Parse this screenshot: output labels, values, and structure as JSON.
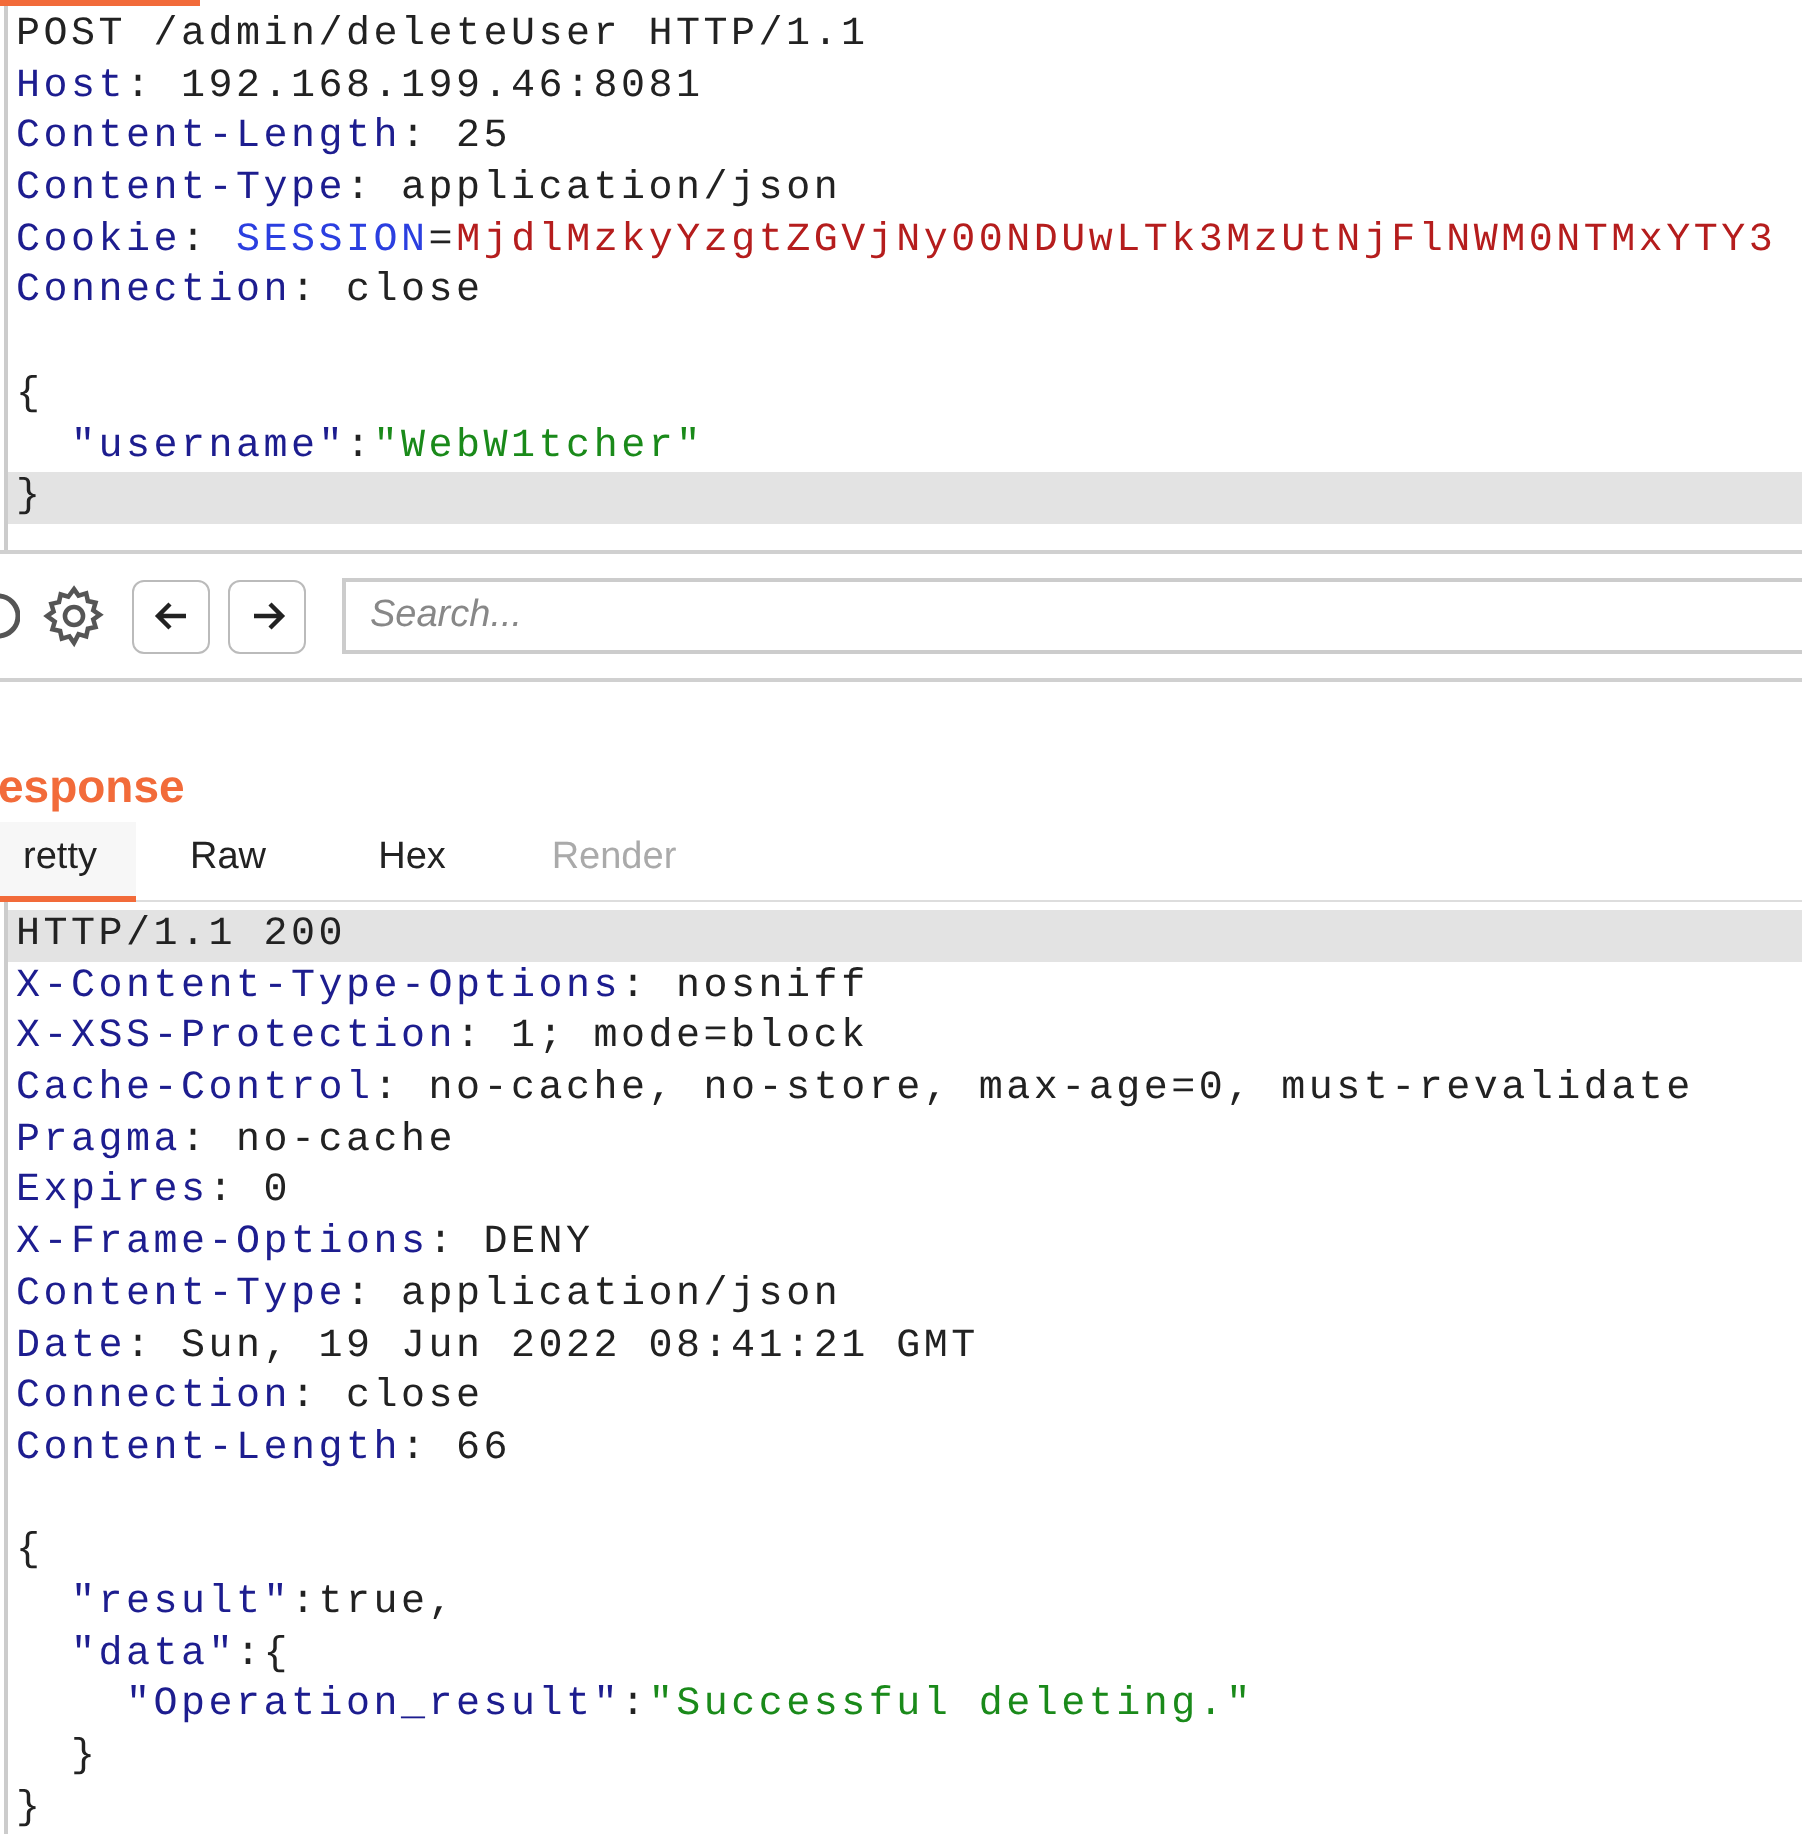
{
  "request": {
    "lines": [
      {
        "current": false,
        "tokens": [
          {
            "kind": "plain",
            "text": "POST /admin/deleteUser HTTP/1.1"
          }
        ]
      },
      {
        "current": false,
        "tokens": [
          {
            "kind": "header",
            "text": "Host"
          },
          {
            "kind": "plain",
            "text": ": 192.168.199.46:8081"
          }
        ]
      },
      {
        "current": false,
        "tokens": [
          {
            "kind": "header",
            "text": "Content-Length"
          },
          {
            "kind": "plain",
            "text": ": 25"
          }
        ]
      },
      {
        "current": false,
        "tokens": [
          {
            "kind": "header",
            "text": "Content-Type"
          },
          {
            "kind": "plain",
            "text": ": application/json"
          }
        ]
      },
      {
        "current": false,
        "tokens": [
          {
            "kind": "header",
            "text": "Cookie"
          },
          {
            "kind": "plain",
            "text": ": "
          },
          {
            "kind": "cookie_name",
            "text": "SESSION"
          },
          {
            "kind": "plain",
            "text": "="
          },
          {
            "kind": "cookie_value",
            "text": "MjdlMzkyYzgtZGVjNy00NDUwLTk3MzUtNjFlNWM0NTMxYTY3"
          }
        ]
      },
      {
        "current": false,
        "tokens": [
          {
            "kind": "header",
            "text": "Connection"
          },
          {
            "kind": "plain",
            "text": ": close"
          }
        ]
      },
      {
        "current": false
      },
      {
        "current": false,
        "tokens": [
          {
            "kind": "plain",
            "text": "{"
          }
        ]
      },
      {
        "current": false,
        "tokens": [
          {
            "kind": "json_key",
            "text": "  \"username\""
          },
          {
            "kind": "plain",
            "text": ":"
          },
          {
            "kind": "json_string",
            "text": "\"WebW1tcher\""
          }
        ]
      },
      {
        "current": true,
        "tokens": [
          {
            "kind": "plain",
            "text": "}"
          }
        ]
      }
    ]
  },
  "toolbar": {
    "search": {
      "placeholder": "Search..."
    }
  },
  "response": {
    "title": "esponse",
    "tabs": [
      {
        "label": "retty",
        "selected": true,
        "disabled": false
      },
      {
        "label": "Raw",
        "selected": false,
        "disabled": false
      },
      {
        "label": "Hex",
        "selected": false,
        "disabled": false
      },
      {
        "label": "Render",
        "selected": false,
        "disabled": true
      }
    ],
    "lines": [
      {
        "current": true,
        "tokens": [
          {
            "kind": "plain",
            "text": "HTTP/1.1 200"
          }
        ]
      },
      {
        "current": false,
        "tokens": [
          {
            "kind": "header",
            "text": "X-Content-Type-Options"
          },
          {
            "kind": "plain",
            "text": ": nosniff"
          }
        ]
      },
      {
        "current": false,
        "tokens": [
          {
            "kind": "header",
            "text": "X-XSS-Protection"
          },
          {
            "kind": "plain",
            "text": ": 1; mode=block"
          }
        ]
      },
      {
        "current": false,
        "tokens": [
          {
            "kind": "header",
            "text": "Cache-Control"
          },
          {
            "kind": "plain",
            "text": ": no-cache, no-store, max-age=0, must-revalidate"
          }
        ]
      },
      {
        "current": false,
        "tokens": [
          {
            "kind": "header",
            "text": "Pragma"
          },
          {
            "kind": "plain",
            "text": ": no-cache"
          }
        ]
      },
      {
        "current": false,
        "tokens": [
          {
            "kind": "header",
            "text": "Expires"
          },
          {
            "kind": "plain",
            "text": ": 0"
          }
        ]
      },
      {
        "current": false,
        "tokens": [
          {
            "kind": "header",
            "text": "X-Frame-Options"
          },
          {
            "kind": "plain",
            "text": ": DENY"
          }
        ]
      },
      {
        "current": false,
        "tokens": [
          {
            "kind": "header",
            "text": "Content-Type"
          },
          {
            "kind": "plain",
            "text": ": application/json"
          }
        ]
      },
      {
        "current": false,
        "tokens": [
          {
            "kind": "header",
            "text": "Date"
          },
          {
            "kind": "plain",
            "text": ": Sun, 19 Jun 2022 08:41:21 GMT"
          }
        ]
      },
      {
        "current": false,
        "tokens": [
          {
            "kind": "header",
            "text": "Connection"
          },
          {
            "kind": "plain",
            "text": ": close"
          }
        ]
      },
      {
        "current": false,
        "tokens": [
          {
            "kind": "header",
            "text": "Content-Length"
          },
          {
            "kind": "plain",
            "text": ": 66"
          }
        ]
      },
      {
        "current": false
      },
      {
        "current": false,
        "tokens": [
          {
            "kind": "plain",
            "text": "{"
          }
        ]
      },
      {
        "current": false,
        "tokens": [
          {
            "kind": "json_key",
            "text": "  \"result\""
          },
          {
            "kind": "plain",
            "text": ":true,"
          }
        ]
      },
      {
        "current": false,
        "tokens": [
          {
            "kind": "json_key",
            "text": "  \"data\""
          },
          {
            "kind": "plain",
            "text": ":{"
          }
        ]
      },
      {
        "current": false,
        "tokens": [
          {
            "kind": "json_key",
            "text": "    \"Operation_result\""
          },
          {
            "kind": "plain",
            "text": ":"
          },
          {
            "kind": "json_string",
            "text": "\"Successful deleting.\""
          }
        ]
      },
      {
        "current": false,
        "tokens": [
          {
            "kind": "plain",
            "text": "  }"
          }
        ]
      },
      {
        "current": false,
        "tokens": [
          {
            "kind": "plain",
            "text": "}"
          }
        ]
      }
    ]
  }
}
